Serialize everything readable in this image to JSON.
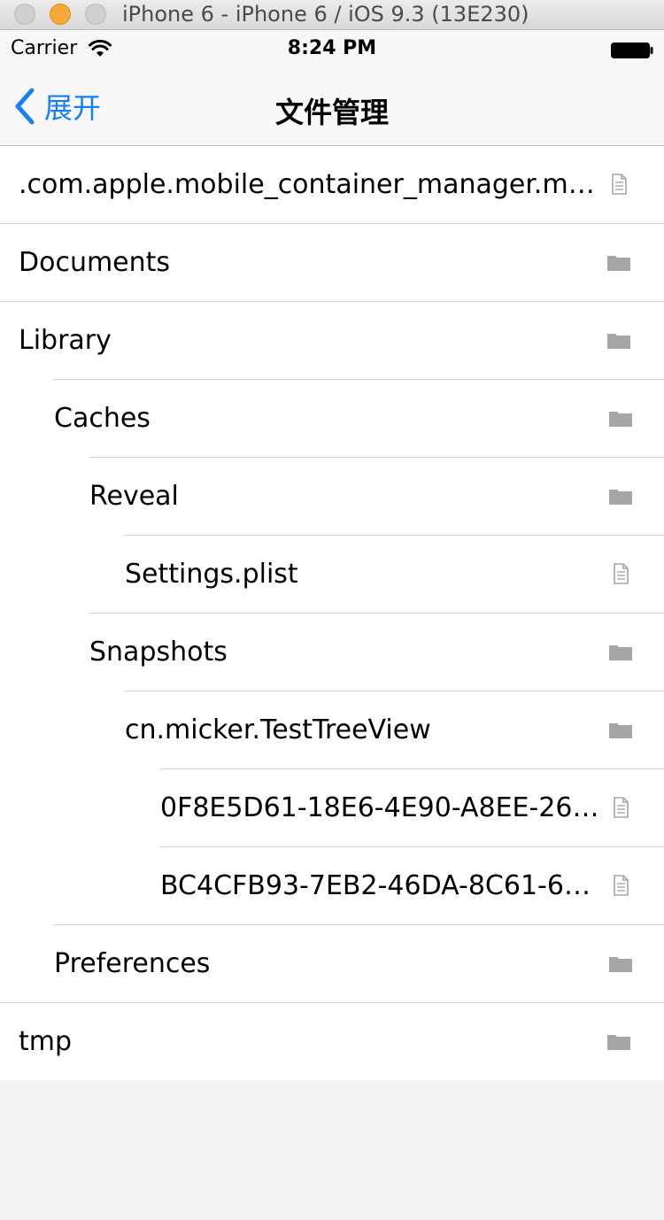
{
  "simulator": {
    "title": "iPhone 6 - iPhone 6 / iOS 9.3 (13E230)"
  },
  "status_bar": {
    "carrier": "Carrier",
    "time": "8:24 PM"
  },
  "nav": {
    "back_label": "展开",
    "title": "文件管理"
  },
  "files": [
    {
      "name": ".com.apple.mobile_container_manager.me...",
      "kind": "file-icon",
      "depth": 0
    },
    {
      "name": "Documents",
      "kind": "folder-icon",
      "depth": 0
    },
    {
      "name": "Library",
      "kind": "folder-icon",
      "depth": 0
    },
    {
      "name": "Caches",
      "kind": "folder-icon",
      "depth": 1
    },
    {
      "name": "Reveal",
      "kind": "folder-icon",
      "depth": 2
    },
    {
      "name": "Settings.plist",
      "kind": "file-icon",
      "depth": 3
    },
    {
      "name": "Snapshots",
      "kind": "folder-icon",
      "depth": 2
    },
    {
      "name": "cn.micker.TestTreeView",
      "kind": "folder-icon",
      "depth": 3
    },
    {
      "name": "0F8E5D61-18E6-4E90-A8EE-265...",
      "kind": "file-icon",
      "depth": 4
    },
    {
      "name": "BC4CFB93-7EB2-46DA-8C61-61...",
      "kind": "file-icon",
      "depth": 4
    },
    {
      "name": "Preferences",
      "kind": "folder-icon",
      "depth": 1
    },
    {
      "name": "tmp",
      "kind": "folder-icon",
      "depth": 0
    }
  ],
  "colors": {
    "accent": "#157efb",
    "icon": "#a6a6a6",
    "separator": "#d6d6d6"
  }
}
